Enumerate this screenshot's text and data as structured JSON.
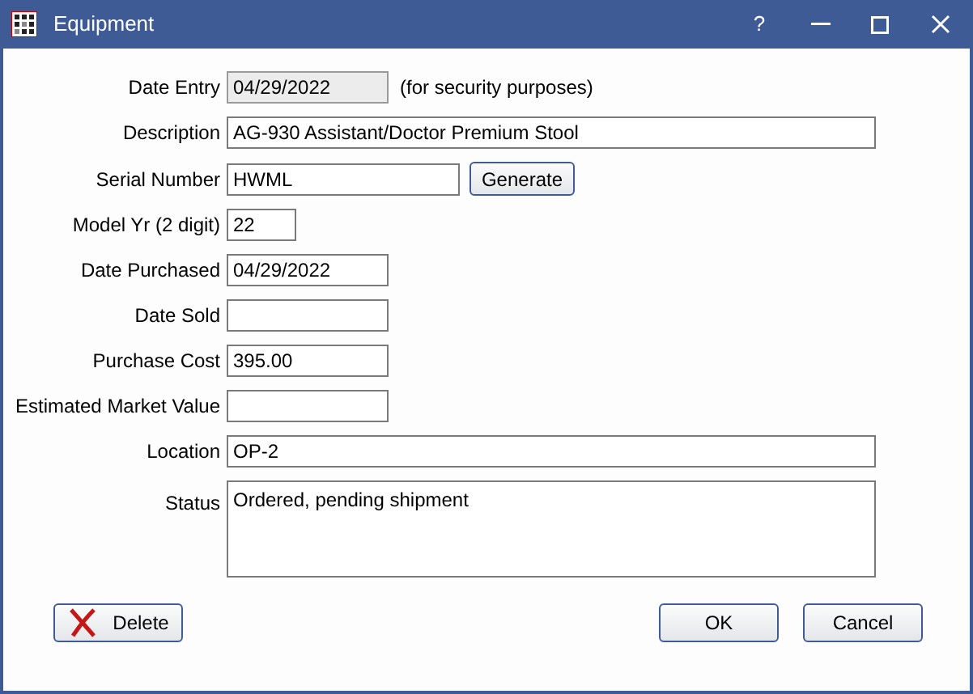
{
  "window": {
    "title": "Equipment",
    "controls": [
      {
        "kind": "help",
        "label": "?"
      },
      {
        "kind": "minimize"
      },
      {
        "kind": "maximize"
      },
      {
        "kind": "close"
      }
    ]
  },
  "fields": [
    {
      "label": "Date Entry",
      "value": "04/29/2022",
      "kind": "short",
      "disabled": true,
      "note": "(for security purposes)"
    },
    {
      "label": "Description",
      "value": "AG-930 Assistant/Doctor Premium Stool",
      "kind": "wide",
      "disabled": false
    },
    {
      "label": "Serial Number",
      "value": "HWML",
      "kind": "medium",
      "disabled": false,
      "button": "Generate"
    },
    {
      "label": "Model Yr (2 digit)",
      "value": "22",
      "kind": "tiny",
      "disabled": false
    },
    {
      "label": "Date Purchased",
      "value": "04/29/2022",
      "kind": "short",
      "disabled": false
    },
    {
      "label": "Date Sold",
      "kind": "short",
      "disabled": false
    },
    {
      "label": "Purchase Cost",
      "value": "395.00",
      "kind": "short",
      "disabled": false
    },
    {
      "label": "Estimated Market Value",
      "kind": "short",
      "disabled": false
    },
    {
      "label": "Location",
      "value": "OP-2",
      "kind": "wide",
      "disabled": false
    },
    {
      "label": "Status",
      "value": "Ordered, pending shipment",
      "kind": "multiline",
      "disabled": false
    }
  ],
  "buttons": [
    {
      "label": "Delete",
      "kind": "delete"
    },
    {
      "label": "OK",
      "kind": "ok"
    },
    {
      "label": "Cancel",
      "kind": "cancel"
    }
  ]
}
